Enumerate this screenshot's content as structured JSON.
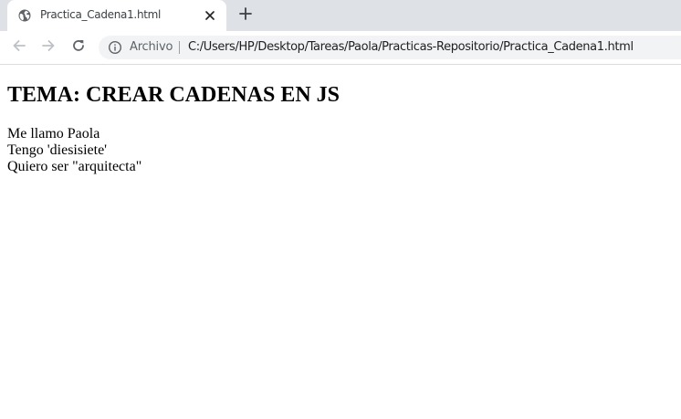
{
  "browser": {
    "tab": {
      "title": "Practica_Cadena1.html",
      "favicon": "globe-icon",
      "close_icon": "close-icon"
    },
    "new_tab_icon": "plus-icon",
    "toolbar": {
      "back_icon": "arrow-left-icon",
      "forward_icon": "arrow-right-icon",
      "reload_icon": "reload-icon",
      "security_icon": "info-icon",
      "security_label": "Archivo",
      "url": "C:/Users/HP/Desktop/Tareas/Paola/Practicas-Repositorio/Practica_Cadena1.html"
    },
    "colors": {
      "tabstrip_bg": "#dee1e6",
      "omnibox_bg": "#f1f3f4",
      "icon_active": "#5f6368",
      "icon_disabled": "#bdc1c6"
    }
  },
  "page": {
    "heading": "TEMA: CREAR CADENAS EN JS",
    "lines": [
      "Me llamo Paola",
      "Tengo 'diesisiete'",
      "Quiero ser \"arquitecta\""
    ]
  }
}
